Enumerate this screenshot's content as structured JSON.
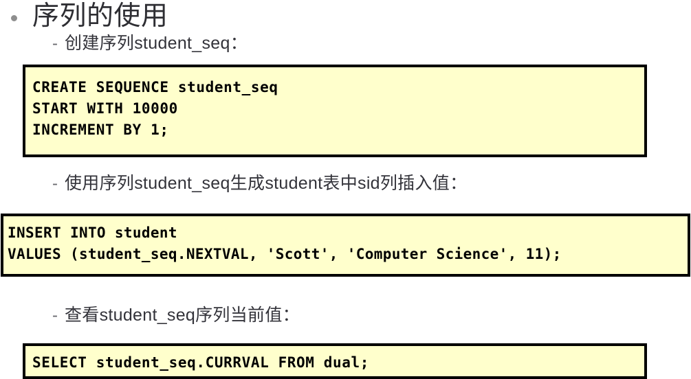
{
  "slide": {
    "title": "序列的使用",
    "bullets": [
      {
        "marker": "-",
        "text": "创建序列student_seq："
      },
      {
        "marker": "-",
        "text": "使用序列student_seq生成student表中sid列插入值："
      },
      {
        "marker": "-",
        "text": "查看student_seq序列当前值："
      }
    ],
    "code_blocks": [
      {
        "id": "create-sequence",
        "code": "CREATE SEQUENCE student_seq\nSTART WITH 10000\nINCREMENT BY 1;"
      },
      {
        "id": "insert-into-student",
        "code": "INSERT INTO student\nVALUES (student_seq.NEXTVAL, 'Scott', 'Computer Science', 11);"
      },
      {
        "id": "select-currval",
        "code": "SELECT student_seq.CURRVAL FROM dual;"
      }
    ],
    "colors": {
      "code_background": "#FFFFCC",
      "code_border": "#000000",
      "title_text": "#2E2E33",
      "bullet_text": "#33333A",
      "bullet_dot": "#8E8E8E",
      "page_background": "#FFFFFF"
    }
  }
}
